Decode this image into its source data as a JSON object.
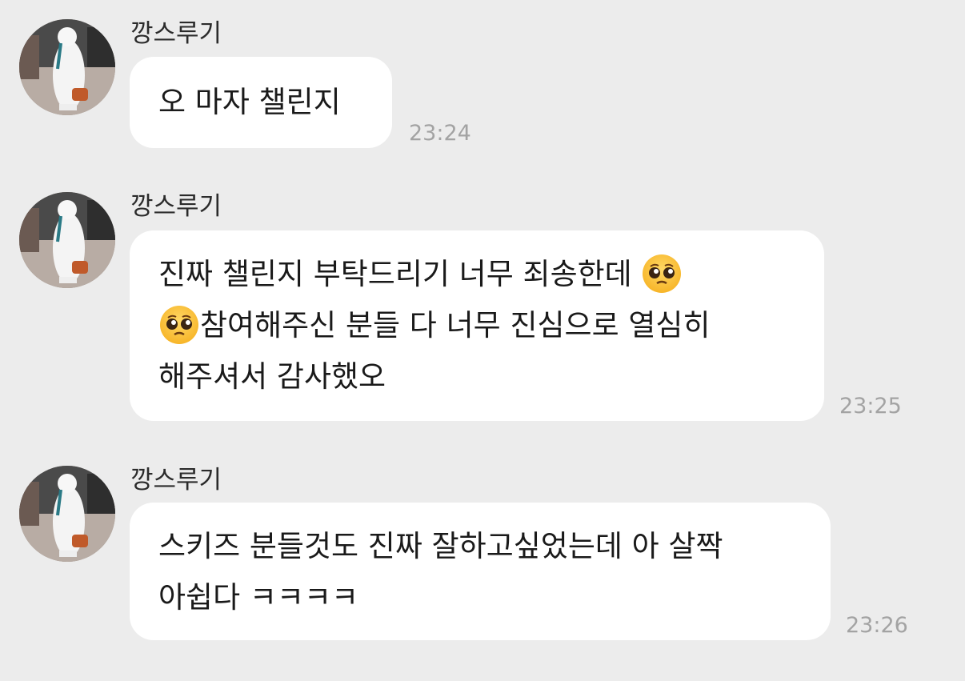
{
  "messages": [
    {
      "sender": "깡스루기",
      "lines": [
        "오 마자 챌린지"
      ],
      "time": "23:24"
    },
    {
      "sender": "깡스루기",
      "lines": [
        {
          "text": "진짜 챌린지 부탁드리기 너무 죄송한데 ",
          "emoji_after": "pleading-face-emoji"
        },
        {
          "emoji_before": "pleading-face-emoji",
          "text": "참여해주신 분들 다 너무 진심으로 열심히"
        },
        {
          "text": "해주셔서 감사했오"
        }
      ],
      "time": "23:25"
    },
    {
      "sender": "깡스루기",
      "lines": [
        "스키즈 분들것도 진짜 잘하고싶었는데 아 살짝",
        "아쉽다 ㅋㅋㅋㅋ"
      ],
      "time": "23:26"
    }
  ],
  "colors": {
    "background": "#ececec",
    "bubble": "#ffffff",
    "timestamp": "#a3a3a3",
    "text": "#1a1a1a"
  }
}
